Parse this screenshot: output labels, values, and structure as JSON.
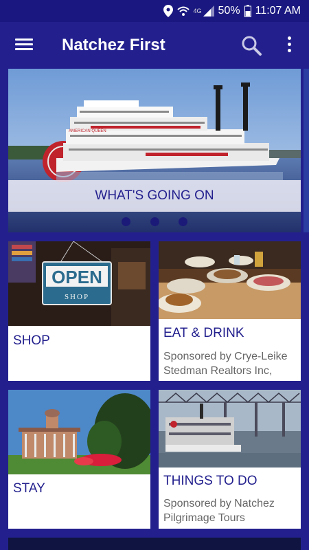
{
  "status_bar": {
    "network": "4G",
    "battery": "50%",
    "time": "11:07 AM"
  },
  "app_bar": {
    "title": "Natchez First"
  },
  "carousel": {
    "label": "WHAT'S GOING ON",
    "page_count": 3
  },
  "cards": [
    {
      "title": "SHOP",
      "sponsor": ""
    },
    {
      "title": "EAT & DRINK",
      "sponsor": "Sponsored by Crye-Leike Stedman Realtors Inc,"
    },
    {
      "title": "STAY",
      "sponsor": ""
    },
    {
      "title": "THINGS TO DO",
      "sponsor": "Sponsored by Natchez Pilgrimage Tours"
    }
  ],
  "images": {
    "riverboat_sign": "AMERICAN QUEEN",
    "shop_sign_main": "OPEN",
    "shop_sign_sub": "SHOP"
  },
  "colors": {
    "primary": "#23208e",
    "status_bar": "#1a1880",
    "card_title": "#23208e",
    "sponsor_text": "#666666"
  }
}
